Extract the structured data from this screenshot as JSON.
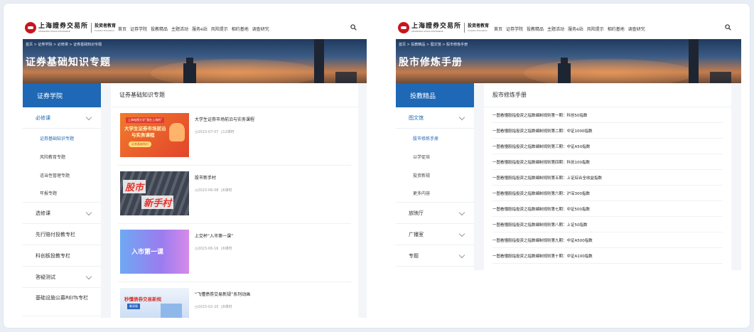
{
  "left_page": {
    "logo": {
      "name": "上海證券交易所",
      "name_en": "SHANGHAI STOCK EXCHANGE",
      "edu": "投资者教育",
      "edu_en": "Investor Education"
    },
    "menu": [
      "首页",
      "证券学院",
      "投教精品",
      "主题活动",
      "服务e站",
      "风险提示",
      "相约基地",
      "调查研究"
    ],
    "breadcrumb": "首页 > 证券学院 > 必修课 > 证券基础知识专题",
    "banner_title": "证券基础知识专题",
    "sidebar": {
      "header": "证券学院",
      "groups": [
        {
          "label": "必修课",
          "sub": [
            "证券基础知识专题",
            "风险教育专题",
            "适当性管理专题",
            "年报专题"
          ]
        },
        {
          "label": "选修课"
        },
        {
          "label": "先行赔付投教专栏"
        },
        {
          "label": "科创板投教专栏"
        },
        {
          "label": "答疑测试"
        },
        {
          "label": "基础设施公募REITs专栏"
        }
      ]
    },
    "main_title": "证券基础知识专题",
    "courses": [
      {
        "title": "大学生证券市场前沿与实务课程",
        "date": "2023-07-07",
        "hours": "12课时",
        "thumb": {
          "l1": "上海电视大学“我在上海的”",
          "l2": "大学生证券市场前沿",
          "l3": "与实务课程",
          "tag": "证券基础知识"
        }
      },
      {
        "title": "股市新手村",
        "date": "2023-06-08",
        "hours": "6课时",
        "thumb": {
          "l1": "股市",
          "l2": "新手村"
        }
      },
      {
        "title": "上交杯“入市第一课”",
        "date": "2023-06-16",
        "hours": "6课时",
        "thumb": {
          "l1": "入市第一课"
        }
      },
      {
        "title": "“飞懂债券交易新规”系列动画",
        "date": "2023-02-20",
        "hours": "8课时",
        "thumb": {
          "l1": "秒懂债券交易新规",
          "l2": "解读版"
        }
      }
    ]
  },
  "right_page": {
    "logo": {
      "name": "上海證券交易所",
      "name_en": "SHANGHAI STOCK EXCHANGE",
      "edu": "投资者教育",
      "edu_en": "Investor Education"
    },
    "menu": [
      "首页",
      "证券学院",
      "投教精品",
      "主题活动",
      "服务e站",
      "风险提示",
      "相约基地",
      "调查研究"
    ],
    "breadcrumb": "首页 > 投教精品 > 图文馆 > 股市修炼手册",
    "banner_title": "股市修炼手册",
    "sidebar": {
      "header": "投教精品",
      "groups": [
        {
          "label": "图文馆",
          "sub": [
            "股市修炼手册",
            "以学促培",
            "投资新规",
            "更多内容"
          ]
        },
        {
          "label": "放映厅"
        },
        {
          "label": "广播室"
        },
        {
          "label": "专题"
        }
      ]
    },
    "main_title": "股市修炼手册",
    "articles": [
      "一图看懂股指投资之指数编制规则第一期：科创50指数",
      "一图看懂股指投资之指数编制规则第二期：中证1000指数",
      "一图看懂股指投资之指数编制规则第三期：中证A50指数",
      "一图看懂股指投资之指数编制规则第四期：科创100指数",
      "一图看懂股指投资之指数编制规则第五期：上证综合全收益指数",
      "一图看懂股指投资之指数编制规则第六期：沪深300指数",
      "一图看懂股指投资之指数编制规则第七期：中证500指数",
      "一图看懂股指投资之指数编制规则第八期：上证50指数",
      "一图看懂股指投资之指数编制规则第九期：中证A500指数",
      "一图看懂股指投资之指数编制规则第十期：中证A100指数"
    ]
  },
  "colors": {
    "primary": "#1e68b5",
    "logo_red": "#c8161e",
    "sidebar_bg": "#f3f5f8"
  }
}
